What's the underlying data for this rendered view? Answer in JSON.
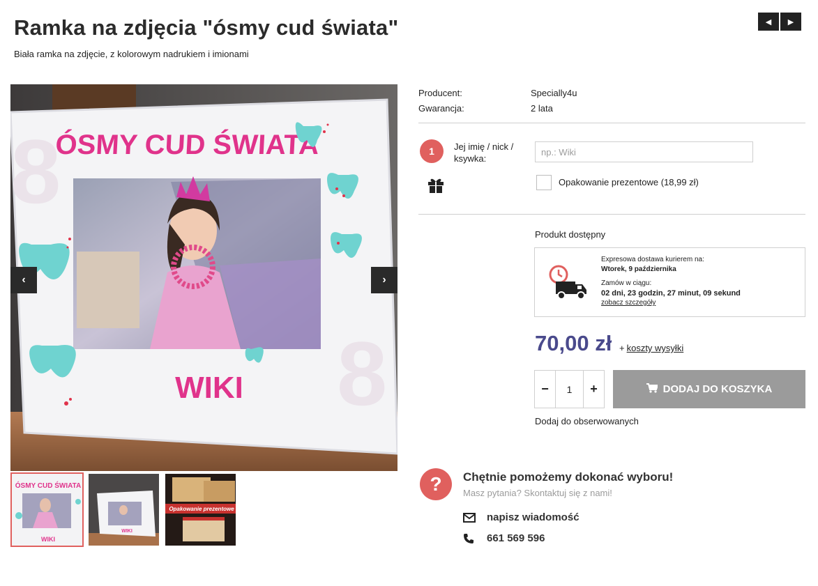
{
  "product": {
    "title": "Ramka na zdjęcia \"ósmy cud świata\"",
    "subtitle": "Biała ramka na zdjęcie, z kolorowym nadrukiem i imionami",
    "frame_text_top": "ÓSMY CUD ŚWIATA",
    "frame_text_bottom": "WIKI",
    "frame_number": "8",
    "thumb3_label": "Opakowanie prezentowe"
  },
  "nav": {
    "prev_icon": "chevron-left-icon",
    "next_icon": "chevron-right-icon"
  },
  "specs": [
    {
      "label": "Producent:",
      "value": "Specially4u"
    },
    {
      "label": "Gwarancja:",
      "value": "2 lata"
    }
  ],
  "personalization": {
    "step": "1",
    "label": "Jej imię / nick / ksywka:",
    "placeholder": "np.: Wiki"
  },
  "gift": {
    "label": "Opakowanie prezentowe (18,99 zł)",
    "checked": false
  },
  "availability": "Produkt dostępny",
  "delivery": {
    "line1": "Expresowa dostawa kurierem na:",
    "date": "Wtorek, 9 października",
    "line2": "Zamów w ciągu:",
    "countdown": "02 dni, 23 godzin, 27 minut, 09 sekund",
    "details_link": "zobacz szczegóły"
  },
  "price": {
    "amount": "70,00 zł",
    "plus": "+",
    "shipping_link": "koszty wysyłki"
  },
  "cart": {
    "qty_minus": "−",
    "quantity": "1",
    "qty_plus": "+",
    "add_label": "DODAJ DO KOSZYKA"
  },
  "watch_label": "Dodaj do obserwowanych",
  "help": {
    "icon_text": "?",
    "title": "Chętnie pomożemy dokonać wyboru!",
    "subtitle": "Masz pytania? Skontaktuj się z nami!",
    "message_label": "napisz wiadomość",
    "phone": "661 569 596"
  },
  "colors": {
    "accent": "#e0605e",
    "price": "#4a4a8c",
    "cart_button": "#9b9b9b",
    "frame_pink": "#e0338b",
    "butterfly": "#6fd3d0"
  }
}
